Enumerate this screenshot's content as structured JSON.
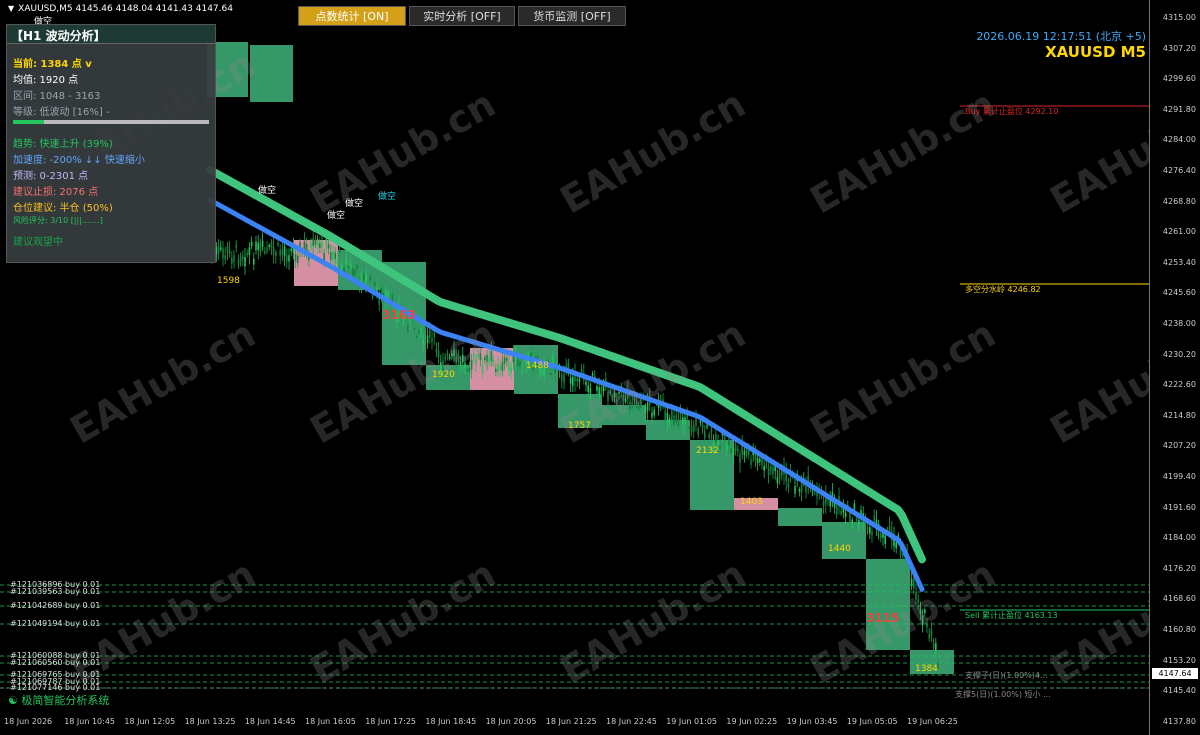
{
  "window": {
    "title": "XAUUSD,M5  4145.46 4148.04 4141.43 4147.64",
    "sub": "做空"
  },
  "toolbar": {
    "btn1": "点数统计 [ON]",
    "btn2": "实时分析 [OFF]",
    "btn3": "货币监测 [OFF]"
  },
  "header": {
    "datetime": "2026.06.19 12:17:51 (北京 +5)",
    "symbol": "XAUUSD M5"
  },
  "panel": {
    "title": "【H1 波动分析】",
    "current": "当前: 1384 点 v",
    "average": "均值: 1920 点",
    "range": "区间: 1048 - 3163",
    "level": "等级: 低波动 [16%] -",
    "level_pct": 16,
    "trend": "趋势: 快速上升 (39%)",
    "accel": "加速度: -200% ↓↓ 快速缩小",
    "forecast": "预测: 0-2301 点",
    "stoploss": "建议止损: 2076 点",
    "position": "仓位建议: 半仓 (50%)",
    "risk": "风险评分: 3/10 [|||.......]",
    "advice": "建议观望中"
  },
  "yaxis": [
    "4315.00",
    "4307.20",
    "4299.60",
    "4291.80",
    "4284.00",
    "4276.40",
    "4268.80",
    "4261.00",
    "4253.40",
    "4245.60",
    "4238.00",
    "4230.20",
    "4222.60",
    "4214.80",
    "4207.20",
    "4199.40",
    "4191.60",
    "4184.00",
    "4176.20",
    "4168.60",
    "4160.80",
    "4153.20",
    "4145.40",
    "4137.80"
  ],
  "xaxis": [
    "18 Jun 2026",
    "18 Jun 10:45",
    "18 Jun 12:05",
    "18 Jun 13:25",
    "18 Jun 14:45",
    "18 Jun 16:05",
    "18 Jun 17:25",
    "18 Jun 18:45",
    "18 Jun 20:05",
    "18 Jun 21:25",
    "18 Jun 22:45",
    "19 Jun 01:05",
    "19 Jun 02:25",
    "19 Jun 03:45",
    "19 Jun 05:05",
    "19 Jun 06:25"
  ],
  "current_price": "4147.64",
  "orders": [
    "#121036896 buy 0.01",
    "#121039563 buy 0.01",
    "#121042689 buy 0.01",
    "#121049194 buy 0.01",
    "#121060088 buy 0.01",
    "#121060560 buy 0.01",
    "#121069765 buy 0.01",
    "#121069787 buy 0.01",
    "#121077146 buy 0.01"
  ],
  "levels": {
    "buy_tp": "Buy 累计止盈位 4292.10",
    "pivot": "多空分水岭 4246.82",
    "sell_tp": "Sell 累计止盈位 4163.13",
    "support1": "支撑子(日)(1.00%)4...",
    "support2": "支撑5(日)(1.00%) 短小 ..."
  },
  "box_labels": [
    "1598",
    "3163",
    "1920",
    "1488",
    "1757",
    "2132",
    "1440",
    "3115",
    "1384",
    "1403"
  ],
  "short_labels": [
    "做空",
    "做空",
    "做空",
    "做空"
  ],
  "footer": "极简智能分析系统",
  "watermark": "EAHub.cn",
  "colors": {
    "up": "#22c55e",
    "down": "#f472b6",
    "band_outer": "#3ec47c",
    "band_inner": "#3b82f6"
  }
}
